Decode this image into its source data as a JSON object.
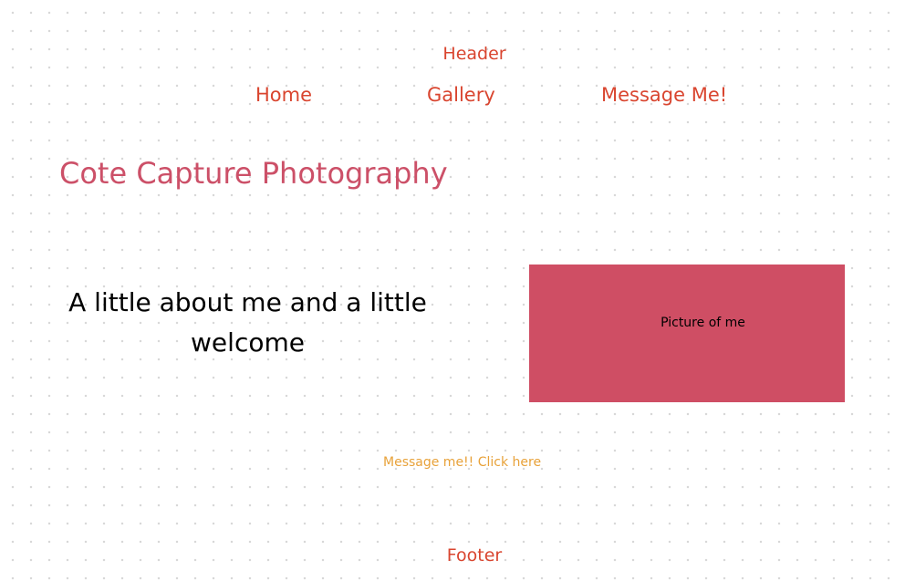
{
  "colors": {
    "nav_red": "#d9452f",
    "title_pink": "#cc5068",
    "picture_bg": "#cf4e64",
    "link_orange": "#e8a23a",
    "text_black": "#000000"
  },
  "header": {
    "label": "Header"
  },
  "nav": {
    "items": [
      {
        "label": "Home"
      },
      {
        "label": "Gallery"
      },
      {
        "label": "Message Me!"
      }
    ]
  },
  "main": {
    "site_title": "Cote Capture Photography",
    "welcome_text": "A little about me and a little welcome",
    "picture_label": "Picture of me",
    "cta_link": "Message me!! Click here"
  },
  "footer": {
    "label": "Footer"
  }
}
